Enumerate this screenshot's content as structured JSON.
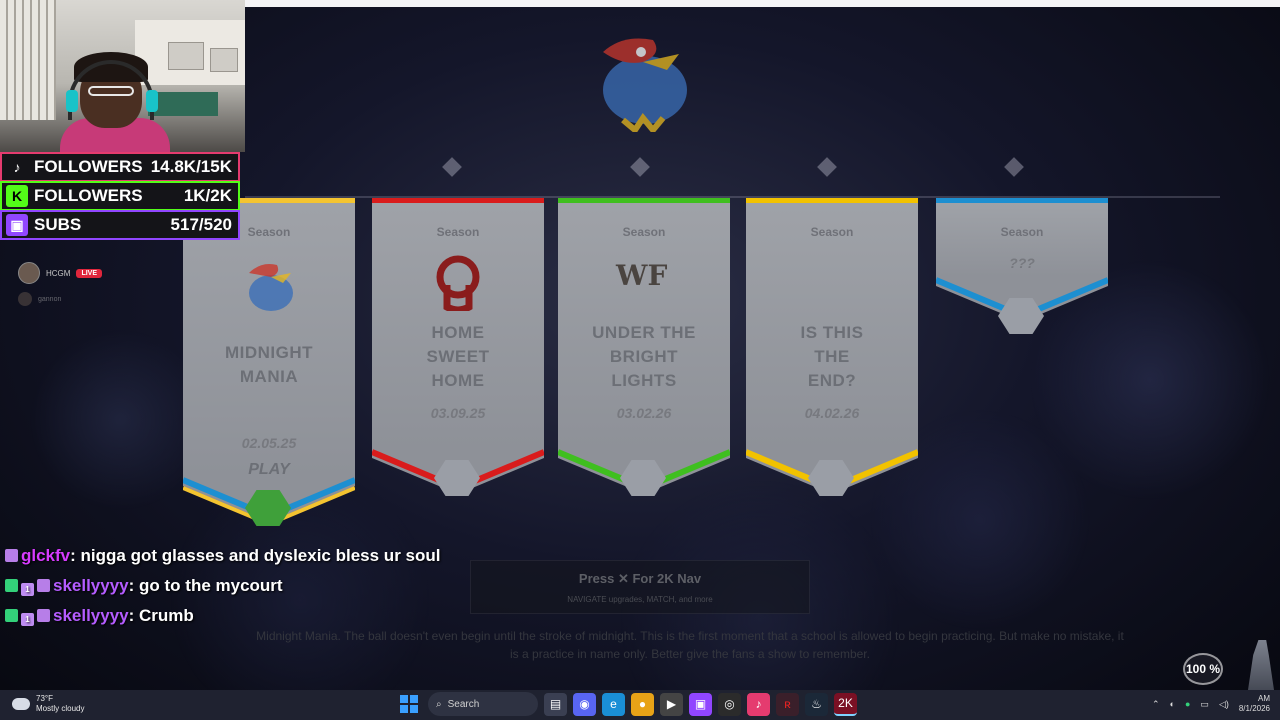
{
  "overlay": {
    "goals": [
      {
        "label": "FOLLOWERS",
        "value": "14.8K/15K",
        "platform": "tiktok-icon",
        "border": "#e53b6f"
      },
      {
        "label": "FOLLOWERS",
        "value": "1K/2K",
        "platform": "kick-icon",
        "border": "#53fc18"
      },
      {
        "label": "SUBS",
        "value": "517/520",
        "platform": "twitch-icon",
        "border": "#9146ff"
      }
    ],
    "live_stream": {
      "name": "HCGM",
      "badge": "LIVE"
    },
    "viewer": {
      "name": "gannon"
    }
  },
  "game": {
    "banners": [
      {
        "kicker": "Season",
        "name": "MIDNIGHT MANIA",
        "date": "02.05.25",
        "action": "PLAY",
        "accent": "#f4c430",
        "team": "jayhawk-logo"
      },
      {
        "kicker": "Season",
        "name": "HOME SWEET HOME",
        "date": "03.09.25",
        "accent": "#d91c1c",
        "team": "ou-logo"
      },
      {
        "kicker": "Season",
        "name": "UNDER THE BRIGHT LIGHTS",
        "date": "03.02.26",
        "accent": "#3fbf1f",
        "team": "wake-logo"
      },
      {
        "kicker": "Season",
        "name": "IS THIS THE END?",
        "date": "04.02.26",
        "accent": "#f2c200",
        "team": ""
      },
      {
        "kicker": "Season",
        "name": "",
        "date": "???",
        "accent": "#1d8fd1",
        "team": ""
      }
    ],
    "prompt": {
      "line": "Press  ✕  For 2K Nav",
      "sub": "NAVIGATE upgrades, MATCH, and more"
    },
    "description": "Midnight Mania. The ball doesn't even begin until the stroke of midnight. This is the first moment that a school is allowed to begin practicing. But make no mistake, it is a practice in name only. Better give the fans a show to remember."
  },
  "chat": [
    {
      "badges": [
        "vid"
      ],
      "user": "glckfv",
      "text": "nigga got glasses and dyslexic bless ur soul",
      "color": "#d63bff"
    },
    {
      "badges": [
        "green",
        "sub",
        "vid"
      ],
      "user": "skellyyyy",
      "text": "go to the mycourt",
      "color": "#b45cff"
    },
    {
      "badges": [
        "green",
        "sub",
        "vid"
      ],
      "user": "skellyyyy",
      "text": "Crumb",
      "color": "#b45cff"
    }
  ],
  "zoom": "100 %",
  "taskbar": {
    "weather_temp": "73°F",
    "weather_desc": "Mostly cloudy",
    "search_placeholder": "Search",
    "time": "AM",
    "date": "8/1/2026"
  }
}
